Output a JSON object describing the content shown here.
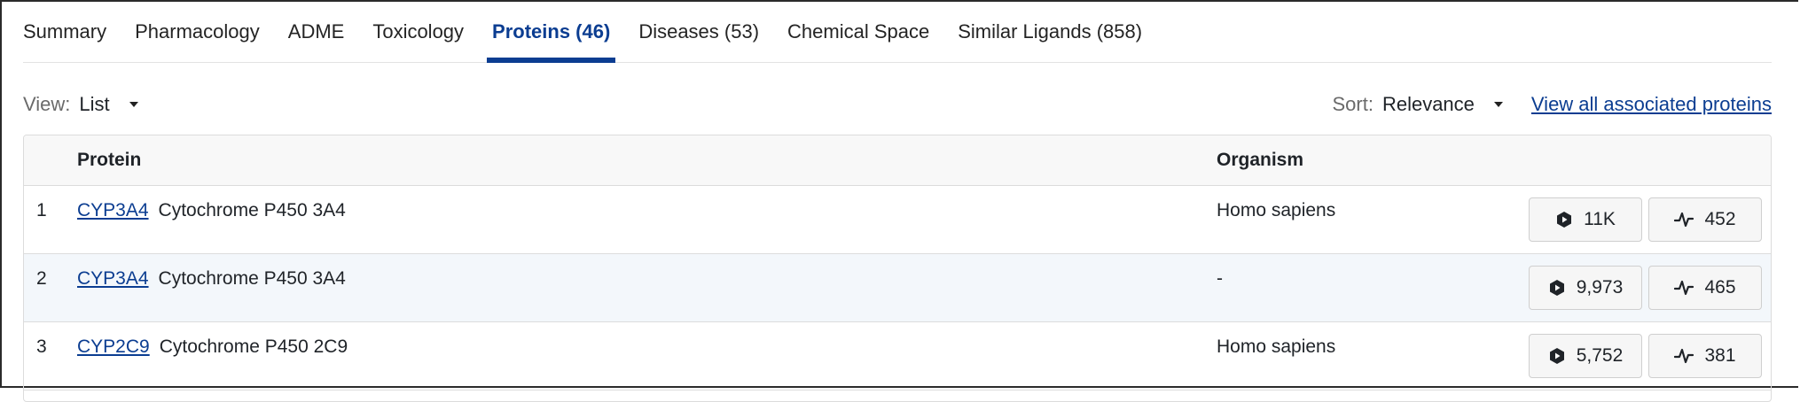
{
  "tabs": [
    {
      "label": "Summary",
      "active": false
    },
    {
      "label": "Pharmacology",
      "active": false
    },
    {
      "label": "ADME",
      "active": false
    },
    {
      "label": "Toxicology",
      "active": false
    },
    {
      "label": "Proteins (46)",
      "active": true
    },
    {
      "label": "Diseases (53)",
      "active": false
    },
    {
      "label": "Chemical Space",
      "active": false
    },
    {
      "label": "Similar Ligands (858)",
      "active": false
    }
  ],
  "controls": {
    "view_label": "View:",
    "view_value": "List",
    "sort_label": "Sort:",
    "sort_value": "Relevance",
    "view_all_link": "View all associated proteins"
  },
  "table": {
    "headers": {
      "protein": "Protein",
      "organism": "Organism"
    },
    "rows": [
      {
        "num": "1",
        "gene": "CYP3A4",
        "name": "Cytochrome P450 3A4",
        "organism": "Homo sapiens",
        "ligands": "11K",
        "activities": "452"
      },
      {
        "num": "2",
        "gene": "CYP3A4",
        "name": "Cytochrome P450 3A4",
        "organism": "-",
        "ligands": "9,973",
        "activities": "465"
      },
      {
        "num": "3",
        "gene": "CYP2C9",
        "name": "Cytochrome P450 2C9",
        "organism": "Homo sapiens",
        "ligands": "5,752",
        "activities": "381"
      }
    ]
  },
  "colors": {
    "accent": "#0b3d91",
    "row_alt": "#f3f7fb",
    "header_bg": "#f8f8f8"
  },
  "icons": {
    "ligand_button": "hexagon-play-icon",
    "activity_button": "activity-pulse-icon",
    "dropdown": "caret-down-icon"
  }
}
